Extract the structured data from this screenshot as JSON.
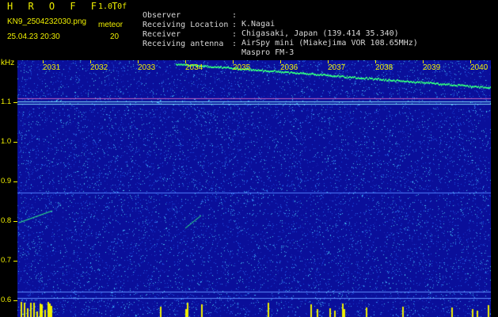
{
  "header": {
    "brand": "H R O F F T",
    "version": "1.0.0f",
    "filename": "KN9_2504232030.png",
    "meteor_label": "meteor",
    "timestamp": "25.04.23 20:30",
    "meteor_count": "20",
    "info": [
      {
        "key": "Observer",
        "value": "K.Nagai"
      },
      {
        "key": "Receiving Location",
        "value": "Chigasaki, Japan (139.414 35.340)"
      },
      {
        "key": "Receiver",
        "value": "AirSpy mini (Miakejima VOR 108.65MHz)"
      },
      {
        "key": "Receiving antenna",
        "value": "Maspro FM-3"
      }
    ]
  },
  "spectrogram": {
    "y_unit": "kHz",
    "y_labels": [
      "1.1",
      "1.0",
      "0.9",
      "0.8",
      "0.7",
      "0.6"
    ],
    "x_labels": [
      "2031",
      "2032",
      "2033",
      "2034",
      "2035",
      "2036",
      "2037",
      "2038",
      "2039",
      "2040"
    ],
    "colors": {
      "background": "#0a0f9a",
      "label": "#f0f000",
      "signal": "#30ff80"
    }
  }
}
